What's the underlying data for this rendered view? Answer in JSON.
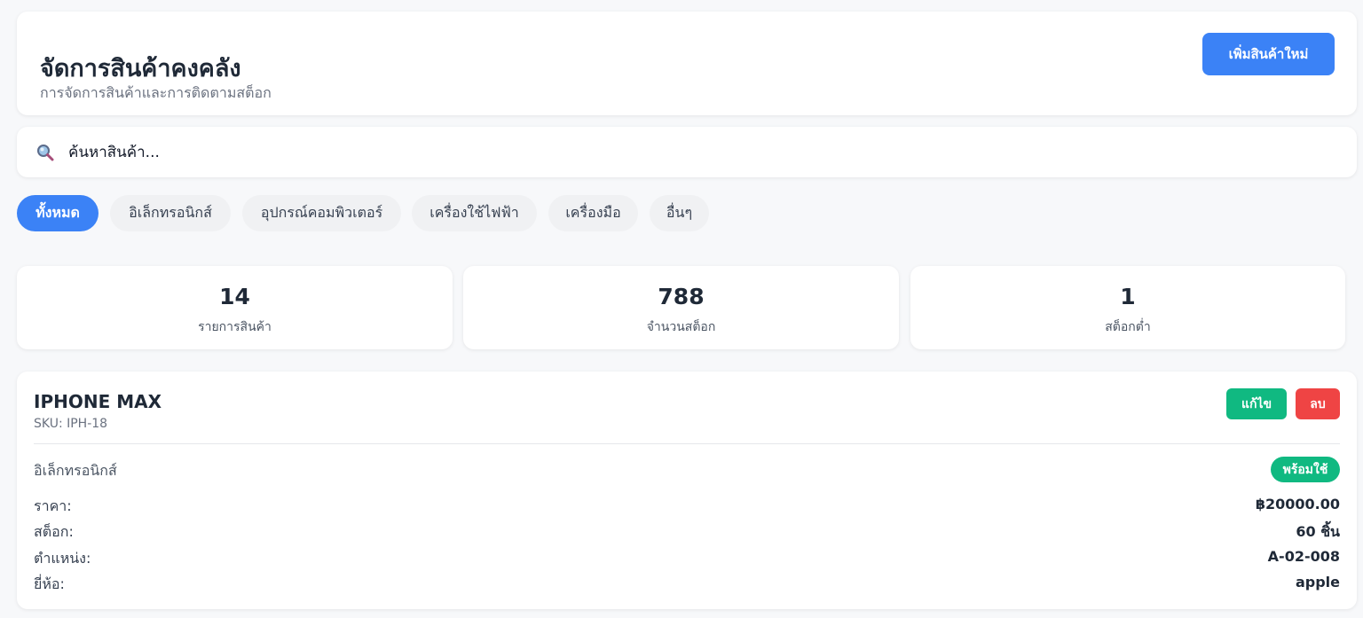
{
  "header": {
    "title": "จัดการสินค้าคงคลัง",
    "subtitle": "การจัดการสินค้าและการติดตามสต็อก",
    "add_button_label": "เพิ่มสินค้าใหม่"
  },
  "search": {
    "icon": "search-icon",
    "placeholder": "ค้นหาสินค้า..."
  },
  "tabs": [
    {
      "label": "ทั้งหมด",
      "active": true
    },
    {
      "label": "อิเล็กทรอนิกส์",
      "active": false
    },
    {
      "label": "อุปกรณ์คอมพิวเตอร์",
      "active": false
    },
    {
      "label": "เครื่องใช้ไฟฟ้า",
      "active": false
    },
    {
      "label": "เครื่องมือ",
      "active": false
    },
    {
      "label": "อื่นๆ",
      "active": false
    }
  ],
  "stats": [
    {
      "value": "14",
      "label": "รายการสินค้า"
    },
    {
      "value": "788",
      "label": "จำนวนสต็อก"
    },
    {
      "value": "1",
      "label": "สต็อกต่ำ"
    }
  ],
  "product": {
    "name": "IPHONE MAX",
    "sku": "SKU: IPH-18",
    "edit_label": "แก้ไข",
    "delete_label": "ลบ",
    "category": "อิเล็กทรอนิกส์",
    "status": "พร้อมใช้",
    "fields": [
      {
        "label": "ราคา:",
        "value": "฿20000.00"
      },
      {
        "label": "สต็อก:",
        "value": "60 ชิ้น"
      },
      {
        "label": "ตำแหน่ง:",
        "value": "A-02-008"
      },
      {
        "label": "ยี่ห้อ:",
        "value": "apple"
      }
    ]
  },
  "colors": {
    "primary": "#3b82f6",
    "success": "#10b981",
    "danger": "#ef4444",
    "background": "#f7f8fa"
  }
}
